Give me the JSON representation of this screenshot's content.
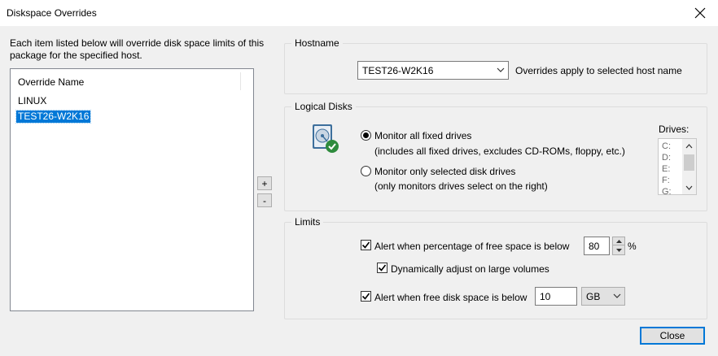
{
  "window": {
    "title": "Diskspace Overrides"
  },
  "intro_text": "Each item listed below will override disk space limits of this package for the specified host.",
  "override_list": {
    "header": "Override Name",
    "items": [
      {
        "label": "LINUX",
        "selected": false
      },
      {
        "label": "TEST26-W2K16",
        "selected": true
      }
    ]
  },
  "list_buttons": {
    "add": "+",
    "remove": "-"
  },
  "hostname_group": {
    "label": "Hostname",
    "selected_host": "TEST26-W2K16",
    "note": "Overrides apply to selected host name"
  },
  "logical_disks_group": {
    "label": "Logical Disks",
    "icon": "hard-disk-check-icon",
    "option_all": {
      "label": "Monitor all fixed drives",
      "sub": "(includes all fixed drives, excludes CD-ROMs, floppy, etc.)",
      "checked": true
    },
    "option_selected": {
      "label": "Monitor only selected disk drives",
      "sub": "(only monitors drives select on the right)",
      "checked": false
    },
    "drives_label": "Drives:",
    "drives": [
      "C:",
      "D:",
      "E:",
      "F:",
      "G:"
    ]
  },
  "limits_group": {
    "label": "Limits",
    "pct_alert": {
      "label": "Alert when percentage of free space is below",
      "checked": true,
      "value": "80",
      "unit": "%"
    },
    "dynamic_adjust": {
      "label": "Dynamically adjust on large volumes",
      "checked": true
    },
    "free_alert": {
      "label": "Alert when free disk space is below",
      "checked": true,
      "value": "10",
      "unit": "GB"
    }
  },
  "close_button": "Close"
}
